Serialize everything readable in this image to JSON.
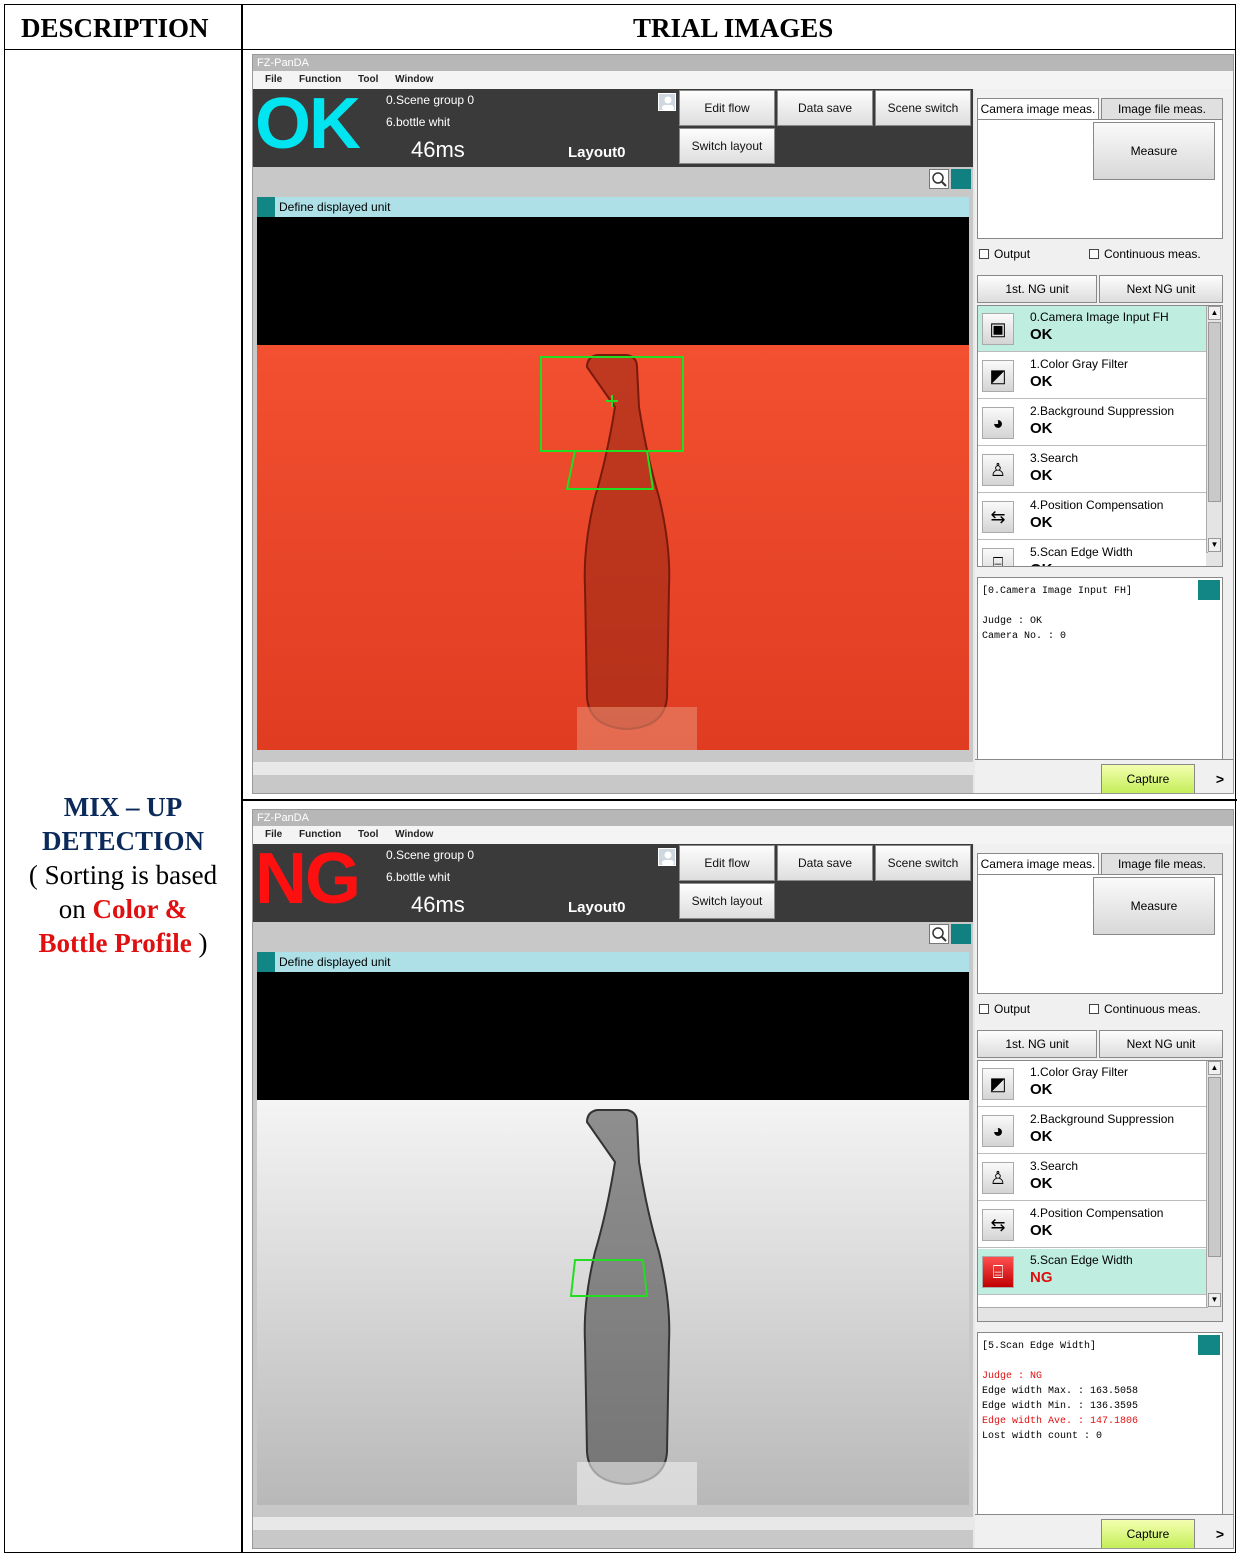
{
  "header": {
    "description": "DESCRIPTION",
    "trial_images": "TRIAL IMAGES"
  },
  "description_cell": {
    "line1": "MIX – UP",
    "line2": "DETECTION",
    "line3": "( Sorting is based",
    "line4_on": "on",
    "line4_color": "Color &",
    "line5_bottle": "Bottle Profile",
    "line5_close": ")"
  },
  "shots": [
    {
      "app_title": "FZ-PanDA",
      "menu": [
        "File",
        "Function",
        "Tool",
        "Window"
      ],
      "judge": "OK",
      "judge_color": "#00e5f0",
      "scene_group": "0.Scene group 0",
      "scene": "6.bottle whit",
      "time": "46ms",
      "layout": "Layout0",
      "buttons": {
        "edit_flow": "Edit flow",
        "data_save": "Data save",
        "scene_switch": "Scene switch",
        "switch_layout": "Switch layout"
      },
      "unit_bar": "Define displayed unit",
      "tabs": [
        "Camera image meas.",
        "Image file meas."
      ],
      "measure": "Measure",
      "output": "Output",
      "continuous": "Continuous meas.",
      "first_ng": "1st. NG unit",
      "next_ng": "Next NG unit",
      "units": [
        {
          "name": "0.Camera Image Input FH",
          "judge": "OK",
          "icon": "camera-icon",
          "highlight": true
        },
        {
          "name": "1.Color Gray Filter",
          "judge": "OK",
          "icon": "filter-icon",
          "highlight": false
        },
        {
          "name": "2.Background Suppression",
          "judge": "OK",
          "icon": "rgb-icon",
          "highlight": false
        },
        {
          "name": "3.Search",
          "judge": "OK",
          "icon": "search-unit-icon",
          "highlight": false
        },
        {
          "name": "4.Position Compensation",
          "judge": "OK",
          "icon": "position-icon",
          "highlight": false
        },
        {
          "name": "5.Scan Edge Width",
          "judge": "OK",
          "icon": "edge-icon",
          "highlight": false
        }
      ],
      "detail_lines": [
        {
          "text": "[0.Camera Image Input FH]",
          "color": "#000"
        },
        {
          "text": "",
          "color": "#000"
        },
        {
          "text": "Judge : OK",
          "color": "#000"
        },
        {
          "text": "Camera No. : 0",
          "color": "#000"
        }
      ],
      "capture": "Capture",
      "more": ">"
    },
    {
      "app_title": "FZ-PanDA",
      "menu": [
        "File",
        "Function",
        "Tool",
        "Window"
      ],
      "judge": "NG",
      "judge_color": "#ff1010",
      "scene_group": "0.Scene group 0",
      "scene": "6.bottle whit",
      "time": "46ms",
      "layout": "Layout0",
      "buttons": {
        "edit_flow": "Edit flow",
        "data_save": "Data save",
        "scene_switch": "Scene switch",
        "switch_layout": "Switch layout"
      },
      "unit_bar": "Define displayed unit",
      "tabs": [
        "Camera image meas.",
        "Image file meas."
      ],
      "measure": "Measure",
      "output": "Output",
      "continuous": "Continuous meas.",
      "first_ng": "1st. NG unit",
      "next_ng": "Next NG unit",
      "units": [
        {
          "name": "1.Color Gray Filter",
          "judge": "OK",
          "icon": "filter-icon",
          "highlight": false
        },
        {
          "name": "2.Background Suppression",
          "judge": "OK",
          "icon": "rgb-icon",
          "highlight": false
        },
        {
          "name": "3.Search",
          "judge": "OK",
          "icon": "search-unit-icon",
          "highlight": false
        },
        {
          "name": "4.Position Compensation",
          "judge": "OK",
          "icon": "position-icon",
          "highlight": false
        },
        {
          "name": "5.Scan Edge Width",
          "judge": "NG",
          "icon": "edge-icon",
          "highlight": true
        }
      ],
      "detail_lines": [
        {
          "text": "[5.Scan Edge Width]",
          "color": "#000"
        },
        {
          "text": "",
          "color": "#000"
        },
        {
          "text": "Judge : NG",
          "color": "#e01010"
        },
        {
          "text": "Edge width Max. : 163.5058",
          "color": "#000"
        },
        {
          "text": "Edge width Min. : 136.3595",
          "color": "#000"
        },
        {
          "text": "Edge width Ave. : 147.1806",
          "color": "#e01010"
        },
        {
          "text": "Lost width count : 0",
          "color": "#000"
        }
      ],
      "capture": "Capture",
      "more": ">"
    }
  ]
}
